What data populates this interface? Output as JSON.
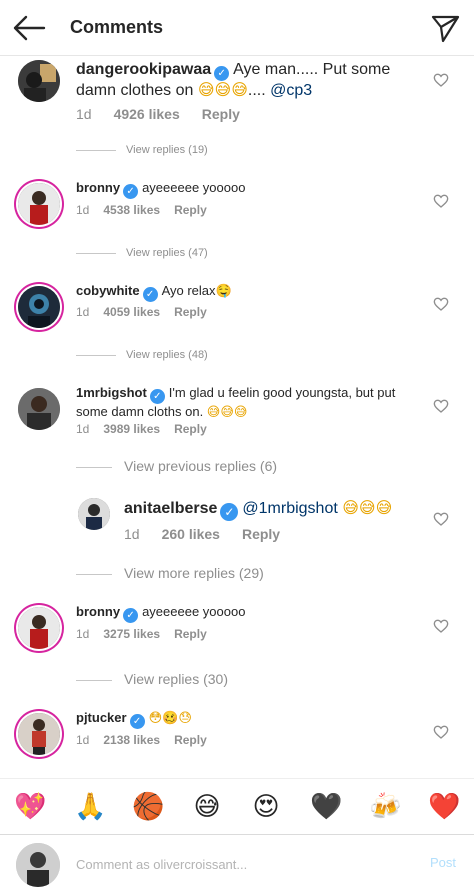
{
  "header": {
    "title": "Comments",
    "back_icon": "arrow-left-icon",
    "send_icon": "paper-plane-icon"
  },
  "comments": [
    {
      "username": "dangerookipawaa",
      "verified": true,
      "text": "Aye man..... Put some damn clothes on ",
      "emoji": "😅😅😅",
      "text_after": ".... ",
      "mention": "@cp3",
      "time": "1d",
      "likes": "4926 likes",
      "reply": "Reply",
      "view_replies": "View replies (19)"
    },
    {
      "username": "bronny",
      "verified": true,
      "text": "ayeeeeee yooooo",
      "time": "1d",
      "likes": "4538 likes",
      "reply": "Reply",
      "view_replies": "View replies (47)"
    },
    {
      "username": "cobywhite",
      "verified": true,
      "text": "Ayo relax",
      "emoji": "🤤",
      "time": "1d",
      "likes": "4059 likes",
      "reply": "Reply",
      "view_replies": "View replies (48)"
    },
    {
      "username": "1mrbigshot",
      "verified": true,
      "text": "I'm glad u feelin good youngsta, but put some damn cloths on. ",
      "emoji": "😅😅😅",
      "time": "1d",
      "likes": "3989 likes",
      "reply": "Reply",
      "view_replies": "View previous replies (6)"
    },
    {
      "username": "anitaelberse",
      "verified": true,
      "mention": "@1mrbigshot",
      "emoji": "😅😅😅",
      "time": "1d",
      "likes": "260 likes",
      "reply": "Reply",
      "view_replies": "View more replies (29)"
    },
    {
      "username": "bronny",
      "verified": true,
      "text": "ayeeeeee yooooo",
      "time": "1d",
      "likes": "3275 likes",
      "reply": "Reply",
      "view_replies": "View replies (30)"
    },
    {
      "username": "pjtucker",
      "verified": true,
      "emoji": "😳🥴😓",
      "time": "1d",
      "likes": "2138 likes",
      "reply": "Reply"
    }
  ],
  "emoji_bar": [
    "💖",
    "🙏",
    "🏀",
    "😅",
    "😍",
    "🖤",
    "🍻",
    "❤️"
  ],
  "input": {
    "placeholder": "Comment as olivercroissant...",
    "post_label": "Post"
  },
  "colors": {
    "verified": "#3897f0",
    "mention": "#003569",
    "post_disabled": "#b2dffc",
    "story_ring": "#d6249f"
  }
}
